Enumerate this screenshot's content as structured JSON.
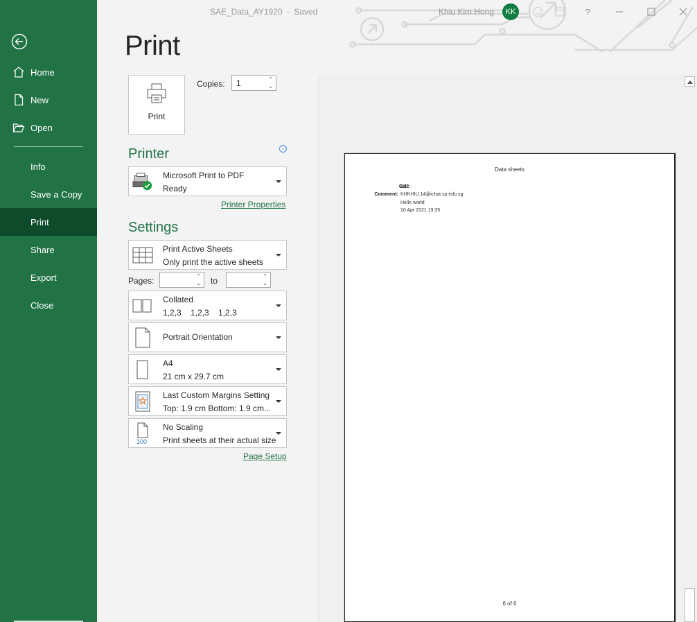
{
  "window": {
    "document_title": "SAE_Data_AY1920",
    "save_status": "Saved",
    "title_separator": "-",
    "user_name": "Khiu Kim Hong",
    "user_initials": "KK",
    "help": "?"
  },
  "sidebar": {
    "back_icon": "back-arrow-icon",
    "items": [
      {
        "label": "Home",
        "icon": "home-icon"
      },
      {
        "label": "New",
        "icon": "new-document-icon"
      },
      {
        "label": "Open",
        "icon": "open-folder-icon"
      },
      {
        "label": "Info"
      },
      {
        "label": "Save a Copy"
      },
      {
        "label": "Print",
        "active": true
      },
      {
        "label": "Share"
      },
      {
        "label": "Export"
      },
      {
        "label": "Close"
      }
    ],
    "accent": "#217346",
    "active_bg": "#0e4b2a"
  },
  "print": {
    "heading": "Print",
    "print_button_label": "Print",
    "copies_label": "Copies:",
    "copies_value": "1"
  },
  "printer": {
    "heading": "Printer",
    "name": "Microsoft Print to PDF",
    "status": "Ready",
    "properties_link": "Printer Properties"
  },
  "settings": {
    "heading": "Settings",
    "what": {
      "line1": "Print Active Sheets",
      "line2": "Only print the active sheets"
    },
    "pages_label": "Pages:",
    "to_label": "to",
    "pages_from": "",
    "pages_to": "",
    "collation": {
      "line1": "Collated",
      "line2": "1,2,3    1,2,3    1,2,3"
    },
    "orientation": {
      "line1": "Portrait Orientation"
    },
    "paper_size": {
      "line1": "A4",
      "line2": "21 cm x 29.7 cm"
    },
    "margins": {
      "line1": "Last Custom Margins Setting",
      "line2": "Top: 1.9 cm Bottom: 1.9 cm..."
    },
    "scaling": {
      "line1": "No Scaling",
      "line2": "Print sheets at their actual size",
      "icon_text": "100"
    },
    "page_setup_link": "Page Setup"
  },
  "preview": {
    "header": "Data sheets",
    "cell_label": "Cell:",
    "cell_value": "E12",
    "comment_label": "Comment:",
    "comment_author": "KHKHIU.14@ichat.sp.edu.sg",
    "comment_text": "Hello world",
    "comment_date": "10 Apr 2021 19:35",
    "footer": "6 of 6"
  }
}
